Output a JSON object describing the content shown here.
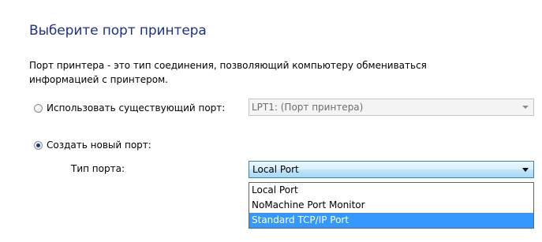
{
  "heading": "Выберите порт принтера",
  "description": "Порт принтера - это тип соединения, позволяющий компьютеру обмениваться информацией с принтером.",
  "use_existing": {
    "label": "Использовать существующий порт:",
    "selected": false,
    "combo_value": "LPT1: (Порт принтера)",
    "enabled": false
  },
  "create_new": {
    "label": "Создать новый порт:",
    "selected": true
  },
  "port_type": {
    "label": "Тип порта:",
    "value": "Local Port",
    "dropdown_open": true,
    "options": [
      {
        "label": "Local Port",
        "highlighted": false
      },
      {
        "label": "NoMachine Port Monitor",
        "highlighted": false
      },
      {
        "label": "Standard TCP/IP Port",
        "highlighted": true
      }
    ]
  },
  "colors": {
    "heading": "#1e3287",
    "highlight": "#3399ff"
  }
}
